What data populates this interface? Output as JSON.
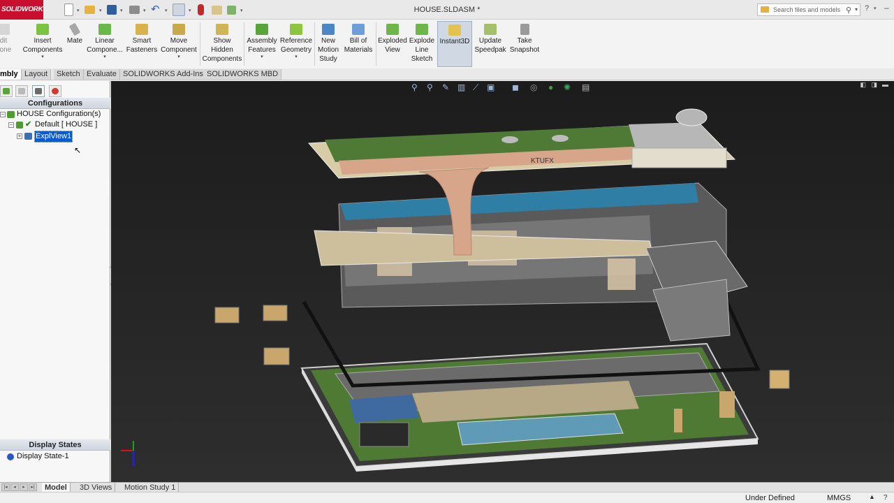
{
  "app": {
    "logo_text": "SOLIDWORKS",
    "document_title": "HOUSE.SLDASM *"
  },
  "search": {
    "placeholder": "Search files and models"
  },
  "ribbon": {
    "commands": [
      {
        "id": "edit-component",
        "label": "dit\nponent"
      },
      {
        "id": "insert-components",
        "label": "Insert\nComponents",
        "caret": "▾"
      },
      {
        "id": "mate",
        "label": "Mate"
      },
      {
        "id": "linear-component",
        "label": "Linear\nCompone...",
        "caret": "▾"
      },
      {
        "id": "smart-fasteners",
        "label": "Smart\nFasteners"
      },
      {
        "id": "move-component",
        "label": "Move\nComponent",
        "caret": "▾"
      },
      {
        "id": "show-hidden",
        "label": "Show\nHidden\nComponents"
      },
      {
        "id": "assembly-features",
        "label": "Assembly\nFeatures",
        "caret": "▾"
      },
      {
        "id": "reference-geometry",
        "label": "Reference\nGeometry",
        "caret": "▾"
      },
      {
        "id": "new-motion-study",
        "label": "New\nMotion\nStudy"
      },
      {
        "id": "bill-of-materials",
        "label": "Bill of\nMaterials"
      },
      {
        "id": "exploded-view",
        "label": "Exploded\nView"
      },
      {
        "id": "explode-line-sketch",
        "label": "Explode\nLine\nSketch"
      },
      {
        "id": "instant3d",
        "label": "Instant3D"
      },
      {
        "id": "update-speedpak",
        "label": "Update\nSpeedpak"
      },
      {
        "id": "take-snapshot",
        "label": "Take\nSnapshot"
      }
    ]
  },
  "tabs": [
    "mbly",
    "Layout",
    "Sketch",
    "Evaluate",
    "SOLIDWORKS Add-Ins",
    "SOLIDWORKS MBD"
  ],
  "pane": {
    "configurations_header": "Configurations",
    "tree": {
      "root": "HOUSE Configuration(s)",
      "default": "Default [ HOUSE ]",
      "explview": "ExplView1"
    },
    "display_states_header": "Display States",
    "display_state": "Display State-1"
  },
  "scene": {
    "sign_text": "KTUFX"
  },
  "bottom_tabs": [
    "Model",
    "3D Views",
    "Motion Study 1"
  ],
  "status": {
    "defined": "Under Defined",
    "units": "MMGS"
  },
  "colors": {
    "accent": "#0a5bd3",
    "logo_red": "#c8102e",
    "viewport_bg": "#262626"
  }
}
